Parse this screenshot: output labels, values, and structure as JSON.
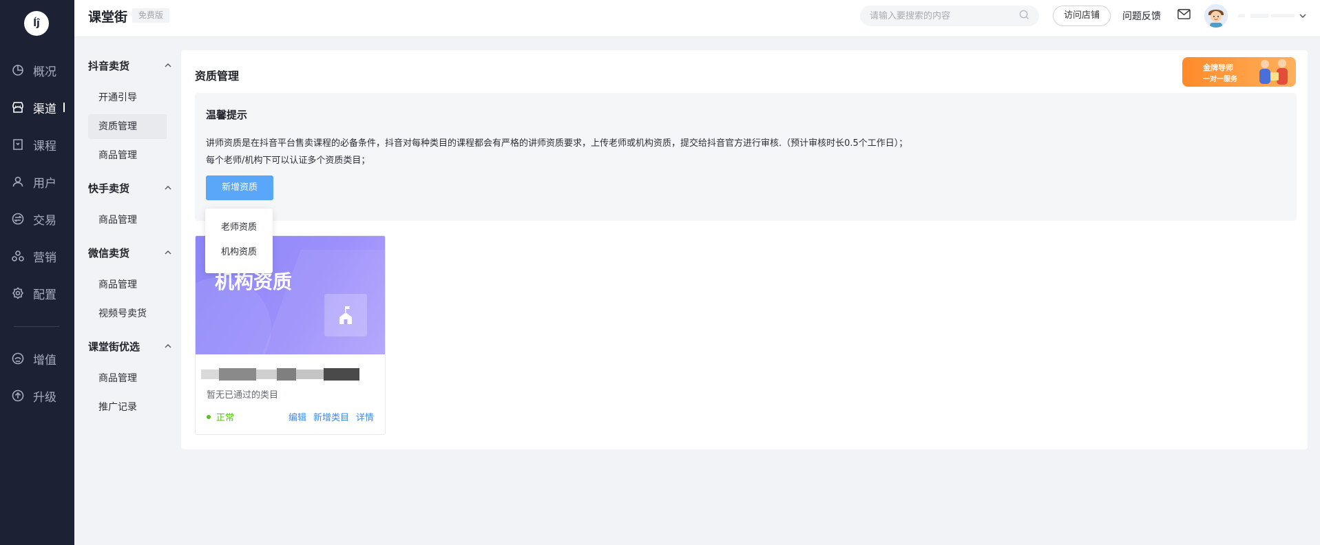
{
  "rail": {
    "logo_text": "ĺĵ",
    "items": [
      {
        "label": "概况",
        "icon": "chart-pie-icon"
      },
      {
        "label": "渠道",
        "icon": "store-icon"
      },
      {
        "label": "课程",
        "icon": "book-icon"
      },
      {
        "label": "用户",
        "icon": "user-icon"
      },
      {
        "label": "交易",
        "icon": "exchange-icon"
      },
      {
        "label": "营销",
        "icon": "marketing-icon"
      },
      {
        "label": "配置",
        "icon": "gear-icon"
      },
      {
        "label": "增值",
        "icon": "value-added-icon"
      },
      {
        "label": "升级",
        "icon": "upgrade-icon"
      }
    ],
    "active": "渠道"
  },
  "header": {
    "brand": "课堂街",
    "badge": "免费版",
    "search_placeholder": "请输入要搜索的内容",
    "visit_label": "访问店铺",
    "feedback_label": "问题反馈"
  },
  "subnav": {
    "groups": [
      {
        "title": "抖音卖货",
        "items": [
          "开通引导",
          "资质管理",
          "商品管理"
        ]
      },
      {
        "title": "快手卖货",
        "items": [
          "商品管理"
        ]
      },
      {
        "title": "微信卖货",
        "items": [
          "商品管理",
          "视频号卖货"
        ]
      },
      {
        "title": "课堂街优选",
        "items": [
          "商品管理",
          "推广记录"
        ]
      }
    ],
    "active_item": "资质管理"
  },
  "main": {
    "title": "资质管理",
    "promo": {
      "line1": "金牌导师",
      "line2": "一对一服务"
    },
    "tip": {
      "title": "温馨提示",
      "line1": "讲师资质是在抖音平台售卖课程的必备条件，抖音对每种类目的课程都会有严格的讲师资质要求，上传老师或机构资质，提交给抖音官方进行审核.（预计审核时长0.5个工作日）；",
      "line2": "每个老师/机构下可以认证多个资质类目；",
      "add_button": "新增资质"
    },
    "dropdown": [
      "老师资质",
      "机构资质"
    ],
    "card": {
      "cover_title": "机构资质",
      "subtitle": "暂无已通过的类目",
      "status": "正常",
      "actions": [
        "编辑",
        "新增类目",
        "详情"
      ]
    }
  },
  "colors": {
    "rail_bg": "#1c2233",
    "primary": "#5aa6f9",
    "link": "#3c8bf5",
    "success": "#52c41a",
    "card_cover": "#9a8ffb",
    "promo": "#ff8a2a"
  }
}
